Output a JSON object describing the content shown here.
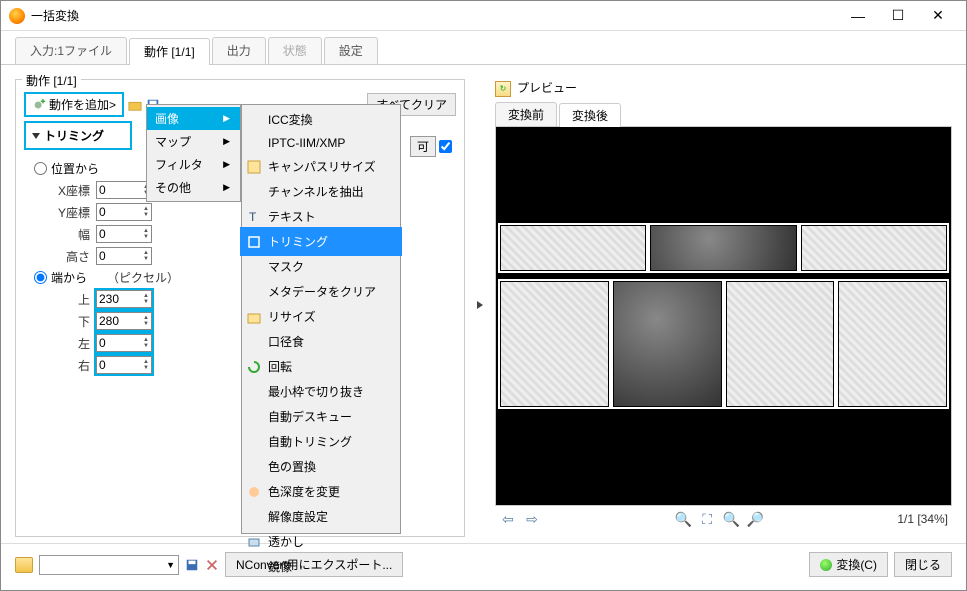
{
  "window": {
    "title": "一括変換",
    "min": "—",
    "max": "☐",
    "close": "✕"
  },
  "main_tabs": {
    "input": "入力:1ファイル",
    "action": "動作 [1/1]",
    "output": "出力",
    "status": "状態",
    "settings": "設定"
  },
  "left": {
    "label": "動作 [1/1]",
    "add_action": "動作を追加>",
    "clear_all": "すべてクリア",
    "perm_ok": "可"
  },
  "submenu": {
    "image": "画像",
    "map": "マップ",
    "filter": "フィルタ",
    "other": "その他"
  },
  "leafmenu": {
    "icc": "ICC変換",
    "iptc": "IPTC-IIM/XMP",
    "canvas": "キャンパスリサイズ",
    "extract": "チャンネルを抽出",
    "text": "テキスト",
    "trim": "トリミング",
    "mask": "マスク",
    "metaclear": "メタデータをクリア",
    "resize": "リサイズ",
    "kuchikui": "口径食",
    "rotate": "回転",
    "mincrop": "最小枠で切り抜き",
    "deskew": "自動デスキュー",
    "autotrim": "自動トリミング",
    "replace": "色の置換",
    "depth": "色深度を変更",
    "resolution": "解像度設定",
    "water": "透かし",
    "mirror": "鏡像"
  },
  "action": {
    "title": "トリミング",
    "from_pos": "位置から",
    "x": "X座標",
    "y": "Y座標",
    "w": "幅",
    "h": "高さ",
    "xv": "0",
    "yv": "0",
    "wv": "0",
    "hv": "0",
    "from_edge": "端から",
    "unit": "（ピクセル）",
    "top": "上",
    "bottom": "下",
    "left": "左",
    "right": "右",
    "tv": "230",
    "bv": "280",
    "lv": "0",
    "rv": "0"
  },
  "preview": {
    "label": "プレビュー",
    "before": "変換前",
    "after": "変換後",
    "page": "1/1 [34%]"
  },
  "bottom": {
    "export": "NConvert用にエクスポート...",
    "convert": "変換(C)",
    "close": "閉じる"
  }
}
